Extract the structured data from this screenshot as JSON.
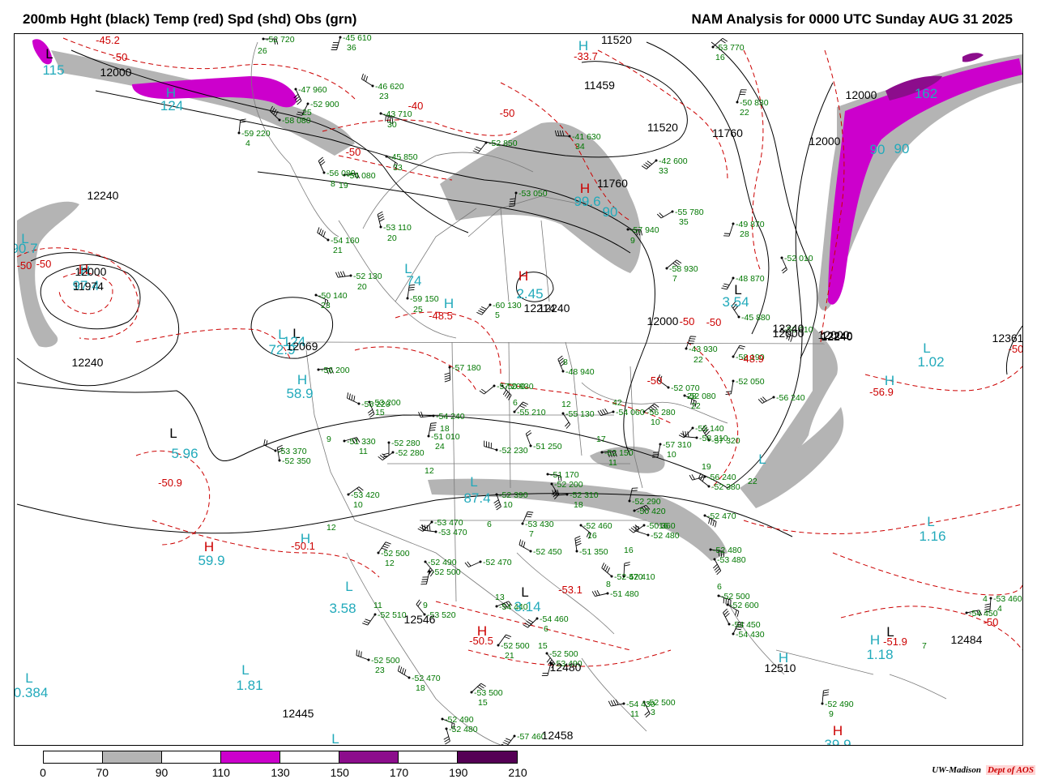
{
  "title_left": "200mb Hght (black) Temp (red) Spd (shd) Obs (grn)",
  "title_right": "NAM Analysis for 0000 UTC Sunday  AUG 31 2025",
  "credit": {
    "org": "UW-Madison",
    "dept": "Dept of AOS"
  },
  "legend": {
    "ticks": [
      "0",
      "70",
      "90",
      "110",
      "130",
      "150",
      "170",
      "190",
      "210"
    ],
    "colors": [
      "#ffffff",
      "#b4b4b4",
      "#ffffff",
      "#cc00cc",
      "#ffffff",
      "#8c0d8c",
      "#ffffff",
      "#550055"
    ]
  },
  "colors": {
    "height_contour": "#000000",
    "temp_contour": "#cc0000",
    "obs": "#007700",
    "speed_label": "#22aabb",
    "shade_70_90": "#b4b4b4",
    "shade_110_130": "#cc00cc",
    "shade_150_170": "#8c0d8c",
    "border": "#7a7a7a"
  },
  "height_labels": [
    "12000",
    "11520",
    "11459",
    "11520",
    "11760",
    "12000",
    "11760",
    "12000",
    "12240",
    "12000",
    "12240",
    "12000",
    "12240",
    "12000",
    "12240",
    "11974",
    "12069",
    "12214",
    "12240",
    "12361",
    "12546",
    "12480",
    "12484",
    "12510",
    "12445",
    "12458",
    "12000",
    "12240"
  ],
  "temp_labels": [
    "-45.2",
    "-50",
    "-50",
    "-50",
    "-50",
    "-40",
    "-50",
    "-33.7",
    "-50",
    "-50",
    "-48.5",
    "-50",
    "-50.9",
    "-50.1",
    "-50",
    "-48.9",
    "-56.9",
    "-50",
    "-50.5",
    "-53.1",
    "-51.9"
  ],
  "speed_labels": [
    "115",
    "124",
    "90.7",
    "124",
    "97.4",
    "74",
    "72.9",
    "58.9",
    "5.96",
    "59.9",
    "87.4",
    "2.45",
    "99.6",
    "90",
    "90",
    "162",
    "3.54",
    "1.02",
    "1.16",
    "3.58",
    "3.14",
    "1.81",
    "0.384",
    "1.18",
    "39.9",
    "90"
  ],
  "hl_marks": [
    "L",
    "H",
    "L",
    "H",
    "L",
    "H",
    "L",
    "H",
    "L",
    "H",
    "L",
    "H",
    "H",
    "H",
    "L",
    "H",
    "L",
    "L",
    "L",
    "L",
    "L",
    "L",
    "L",
    "H",
    "L",
    "L",
    "H",
    "H",
    "H",
    "L",
    "H",
    "H"
  ],
  "obs": [
    "-52 720",
    "26",
    "-45 610",
    "36",
    "-46 620",
    "23",
    "-53 770",
    "16",
    "-47 960",
    "-52 900",
    "25",
    "-58 080",
    "-59 220",
    "4",
    "-43 710",
    "30",
    "-52 850",
    "-41 630",
    "34",
    "-50 830",
    "22",
    "-45 850",
    "33",
    "-42 600",
    "33",
    "-56 080",
    "8",
    "-54 080",
    "19",
    "-53 050",
    "-55 780",
    "35",
    "-53 110",
    "20",
    "-57 940",
    "9",
    "-49 870",
    "28",
    "-54 160",
    "21",
    "-58 930",
    "7",
    "-52 010",
    "-48 870",
    "-52 130",
    "20",
    "-59 150",
    "25",
    "-50 140",
    "23",
    "-60 130",
    "5",
    "-45 880",
    "-43 930",
    "22",
    "-50 010",
    "-57 180",
    "-57 200",
    "8",
    "-48 940",
    "-58 190",
    "-56 200",
    "-50 930",
    "-52 050",
    "-56 240",
    "-56 220",
    "6",
    "-55 210",
    "12",
    "-55 130",
    "42",
    "-54 060",
    "-52 070",
    "28",
    "-56 280",
    "10",
    "-53 200",
    "15",
    "-54 240",
    "18",
    "-51 010",
    "24",
    "-52 080",
    "22",
    "-55 140",
    "-58 310",
    "-57 320",
    "9",
    "-51 330",
    "11",
    "-52 280",
    "-52 280",
    "-52 230",
    "-51 250",
    "17",
    "-52 150",
    "11",
    "-57 310",
    "10",
    "-53 370",
    "-52 350",
    "12",
    "-51 170",
    "-52 200",
    "19",
    "-56 240",
    "-52 380",
    "22",
    "-53 420",
    "10",
    "-52 390",
    "10",
    "-52 310",
    "18",
    "-52 290",
    "-50 420",
    "-52 470",
    "12",
    "-53 470",
    "-53 470",
    "6",
    "-53 430",
    "7",
    "-52 460",
    "16",
    "-50 360",
    "-52 480",
    "16",
    "-52 500",
    "12",
    "-52 490",
    "-52 500",
    "-52 470",
    "-52 450",
    "-51 350",
    "16",
    "-52 480",
    "-53 480",
    "8",
    "-51 480",
    "-52 470",
    "-52 410",
    "6",
    "-52 500",
    "11",
    "-52 510",
    "9",
    "-53 520",
    "13",
    "-54 440",
    "-52 600",
    "4",
    "-54 460",
    "6",
    "-54 450",
    "-54 430",
    "-54 450",
    "7",
    "-53 460",
    "4",
    "-52 500",
    "23",
    "-52 500",
    "21",
    "-52 500",
    "-53 490",
    "15",
    "-52 470",
    "18",
    "-53 500",
    "15",
    "-52 500",
    "3",
    "-54 430",
    "11",
    "-52 490",
    "9",
    "-52 490",
    "-52 480",
    "-57 460"
  ]
}
